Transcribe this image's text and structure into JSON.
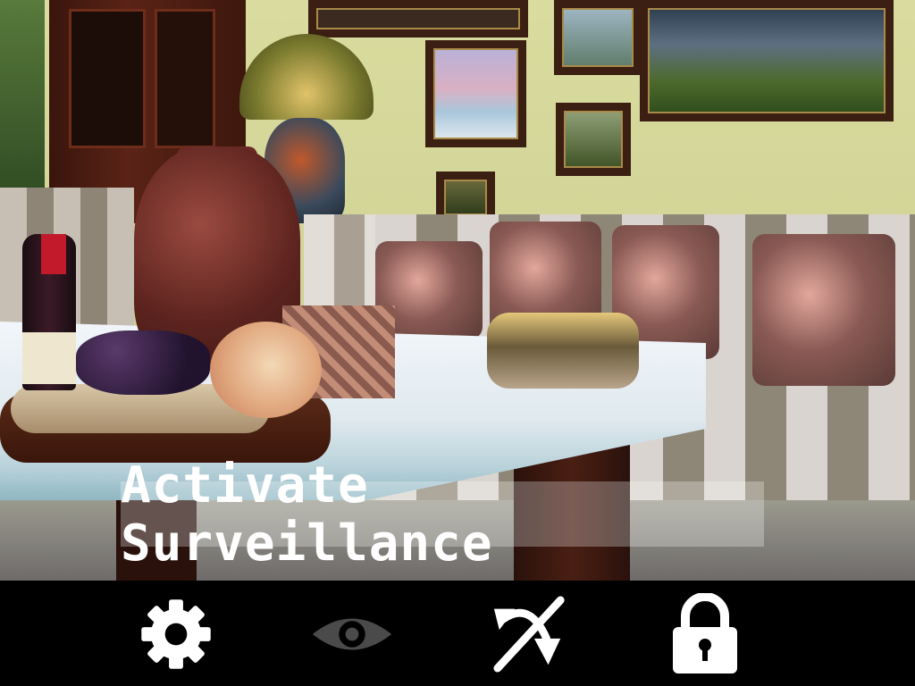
{
  "preview": {
    "overlay_label": "Activate Surveillance"
  },
  "toolbar": {
    "items": [
      {
        "icon": "gear-icon",
        "color": "#ffffff",
        "enabled": true
      },
      {
        "icon": "eye-icon",
        "color": "#4a4a4a",
        "enabled": false
      },
      {
        "icon": "switch-camera-icon",
        "color": "#ffffff",
        "enabled": true
      },
      {
        "icon": "lock-icon",
        "color": "#ffffff",
        "enabled": true
      }
    ]
  }
}
